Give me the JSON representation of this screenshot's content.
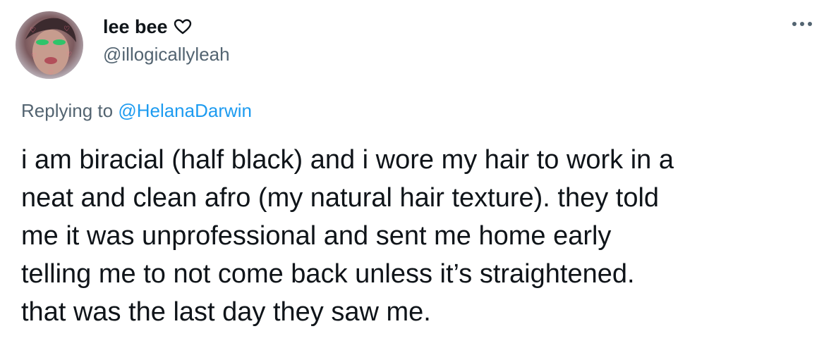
{
  "user": {
    "display_name": "lee bee",
    "handle": "@illogicallyleah",
    "name_badge_icon": "heart-outline-icon"
  },
  "header": {
    "more_icon": "more-options-icon"
  },
  "reply": {
    "prefix": "Replying to",
    "mention": "@HelanaDarwin"
  },
  "tweet": {
    "lines": [
      "i am biracial (half black) and i wore my hair to work in a",
      "neat and clean afro (my natural hair texture). they told",
      "me it was unprofessional and sent me home early",
      "telling me to not come back unless it’s straightened.",
      "that was the last day they saw me."
    ]
  },
  "colors": {
    "text": "#0f1419",
    "secondary": "#536471",
    "link": "#1d9bf0"
  }
}
